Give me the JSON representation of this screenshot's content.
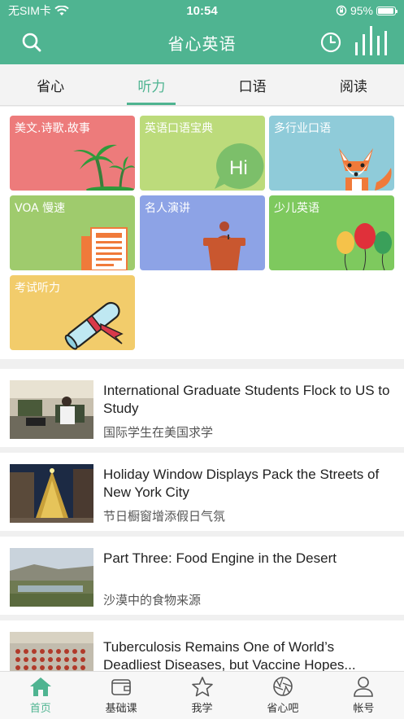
{
  "status": {
    "carrier": "无SIM卡",
    "time": "10:54",
    "battery": "95%",
    "battery_level": 0.95
  },
  "header": {
    "title": "省心英语"
  },
  "tabs": [
    {
      "label": "省心"
    },
    {
      "label": "听力"
    },
    {
      "label": "口语"
    },
    {
      "label": "阅读"
    }
  ],
  "active_tab": "听力",
  "categories": [
    {
      "label": "美文.诗歌.故事",
      "color": "#ed7b7b",
      "icon": "palm-tree-icon"
    },
    {
      "label": "英语口语宝典",
      "color": "#bcdb7b",
      "icon": "hi-bubble-icon"
    },
    {
      "label": "多行业口语",
      "color": "#8fcbd9",
      "icon": "fox-icon"
    },
    {
      "label": "VOA 慢速",
      "color": "#9fcb6d",
      "icon": "newspaper-icon"
    },
    {
      "label": "名人演讲",
      "color": "#8da3e6",
      "icon": "podium-icon"
    },
    {
      "label": "少儿英语",
      "color": "#7ec95e",
      "icon": "balloons-icon"
    },
    {
      "label": "考试听力",
      "color": "#f2cc6b",
      "icon": "diploma-icon"
    }
  ],
  "articles": [
    {
      "title": "International Graduate Students Flock to US to Study",
      "subtitle": "国际学生在美国求学"
    },
    {
      "title": "Holiday Window Displays Pack the Streets of New York City",
      "subtitle": "节日橱窗增添假日气氛"
    },
    {
      "title": "Part Three: Food Engine in the Desert",
      "subtitle": "沙漠中的食物来源"
    },
    {
      "title": "Tuberculosis Remains One of World’s Deadliest Diseases, but Vaccine Hopes...",
      "subtitle": ""
    }
  ],
  "tabbar": [
    {
      "label": "首页",
      "icon": "home-icon"
    },
    {
      "label": "基础课",
      "icon": "wallet-icon"
    },
    {
      "label": "我学",
      "icon": "star-icon"
    },
    {
      "label": "省心吧",
      "icon": "aperture-icon"
    },
    {
      "label": "帐号",
      "icon": "user-icon"
    }
  ],
  "colors": {
    "brand": "#4fb491"
  }
}
